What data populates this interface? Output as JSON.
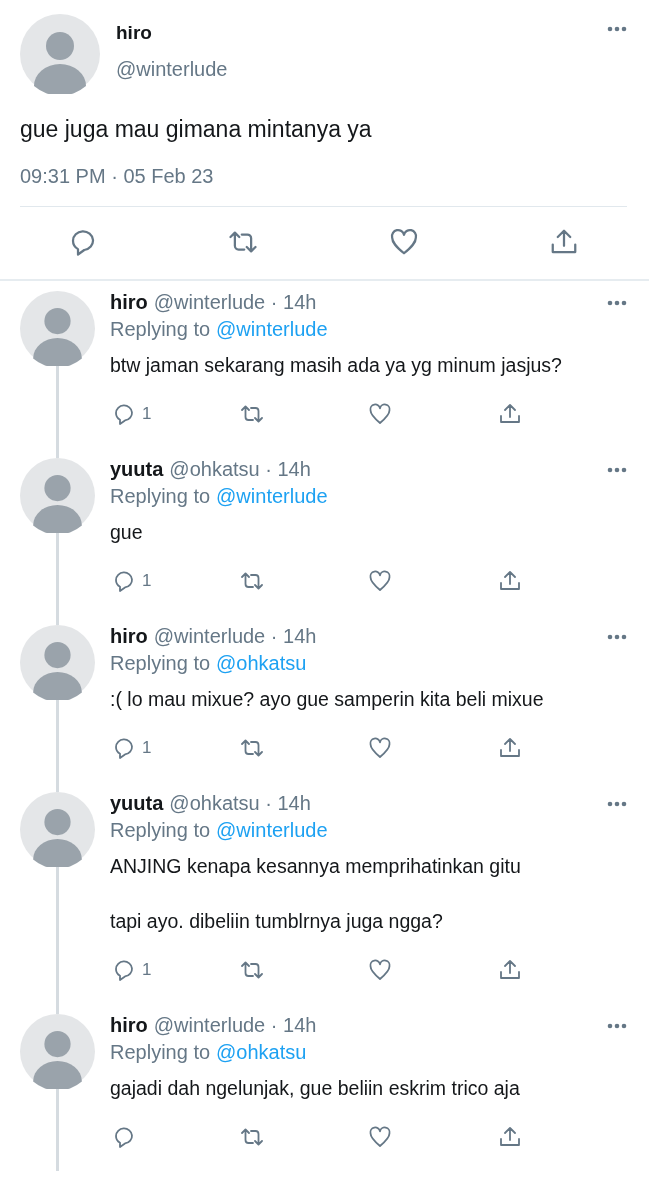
{
  "tweet": {
    "name": "hiro",
    "handle": "@winterlude",
    "text": "gue juga mau gimana mintanya ya",
    "timestamp": "09:31 PM · 05 Feb 23"
  },
  "replies": [
    {
      "name": "hiro",
      "byline": "@winterlude · 14h",
      "replying_label": "Replying to",
      "replying_to": "@winterlude",
      "paragraphs": [
        "btw jaman sekarang masih ada ya yg minum jasjus?"
      ],
      "reply_count": "1"
    },
    {
      "name": "yuuta",
      "byline": "@ohkatsu · 14h",
      "replying_label": "Replying to",
      "replying_to": "@winterlude",
      "paragraphs": [
        "gue"
      ],
      "reply_count": "1"
    },
    {
      "name": "hiro",
      "byline": "@winterlude · 14h",
      "replying_label": "Replying to",
      "replying_to": "@ohkatsu",
      "paragraphs": [
        ":( lo mau mixue? ayo gue samperin kita beli mixue"
      ],
      "reply_count": "1"
    },
    {
      "name": "yuuta",
      "byline": "@ohkatsu · 14h",
      "replying_label": "Replying to",
      "replying_to": "@winterlude",
      "paragraphs": [
        "ANJING kenapa kesannya memprihatinkan gitu",
        "tapi ayo. dibeliin tumblrnya juga ngga?"
      ],
      "reply_count": "1"
    },
    {
      "name": "hiro",
      "byline": "@winterlude · 14h",
      "replying_label": "Replying to",
      "replying_to": "@ohkatsu",
      "paragraphs": [
        "gajadi dah ngelunjak, gue beliin eskrim trico aja"
      ]
    }
  ]
}
